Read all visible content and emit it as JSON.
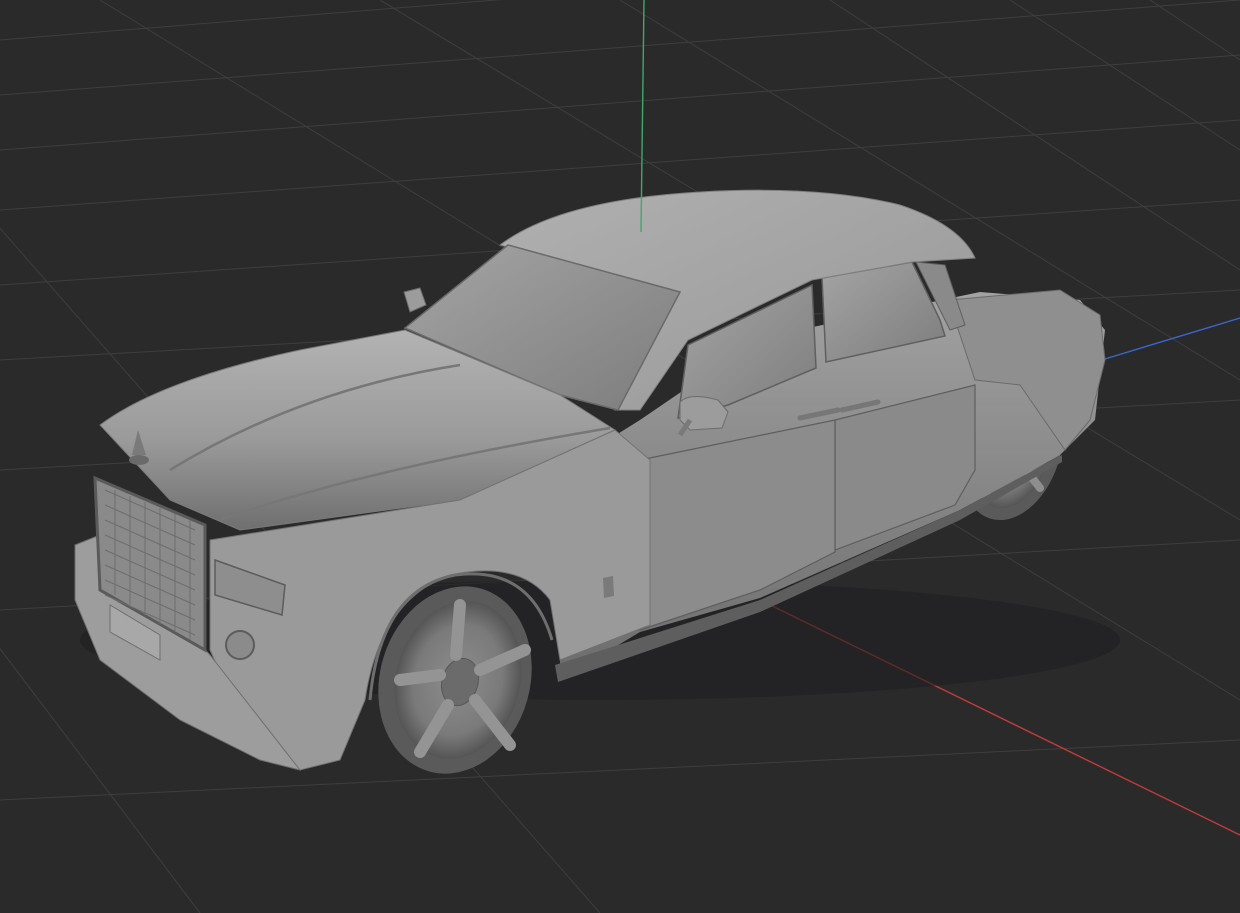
{
  "viewport": {
    "name": "3D viewport",
    "background": "#2a2a2b",
    "grid_color": "#3e3e40",
    "show_grid": true
  },
  "axes": {
    "x_color": "#c23b3b",
    "y_color": "#3a66c8",
    "z_color": "#3fa86a"
  },
  "model": {
    "name": "car-model",
    "material": "clay",
    "body_color": "#9c9c9c",
    "shadow_color": "#6e6e6e",
    "highlight_color": "#bcbcbc"
  }
}
